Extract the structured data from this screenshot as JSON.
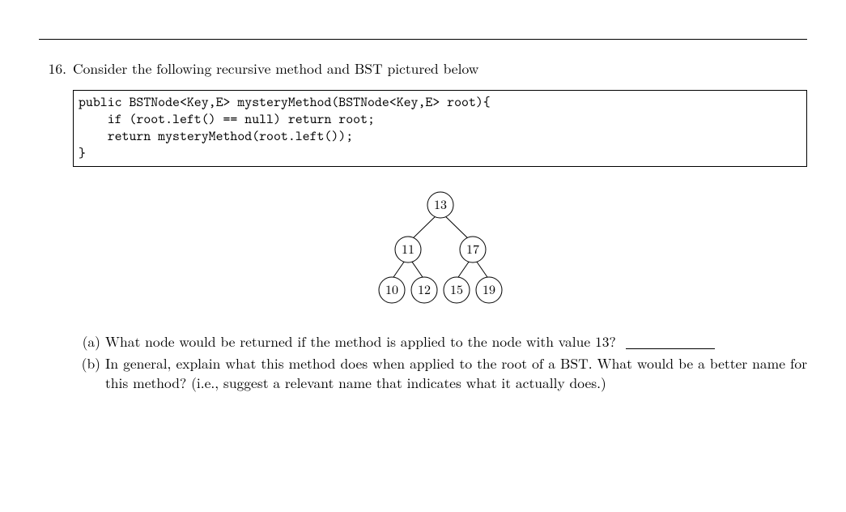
{
  "problem_number": "16.",
  "prompt": "Consider the following recursive method and BST pictured below",
  "code_lines": [
    "public BSTNode<Key,E> mysteryMethod(BSTNode<Key,E> root){",
    "    if (root.left() == null) return root;",
    "    return mysteryMethod(root.left());",
    "}"
  ],
  "tree": {
    "root": "13",
    "left": {
      "value": "11",
      "left": "10",
      "right": "12"
    },
    "right": {
      "value": "17",
      "left": "15",
      "right": "19"
    }
  },
  "subparts": {
    "a": {
      "label": "(a)",
      "text": "What node would be returned if the method is applied to the node with value 13?"
    },
    "b": {
      "label": "(b)",
      "text": "In general, explain what this method does when applied to the root of a BST. What would be a better name for this method? (i.e., suggest a relevant name that indicates what it actually does.)"
    }
  }
}
